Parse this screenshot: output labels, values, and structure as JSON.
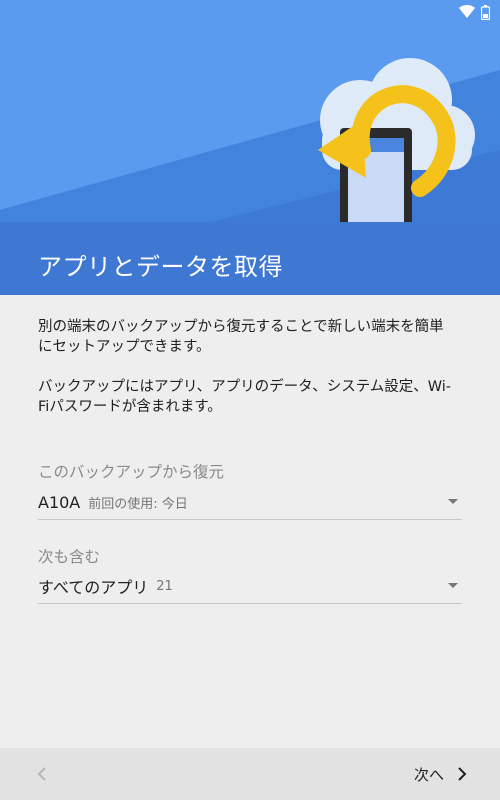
{
  "status_bar": {
    "wifi_icon": "wifi-icon",
    "battery_icon": "battery-icon"
  },
  "header": {
    "title": "アプリとデータを取得",
    "accent": "#3f78d2"
  },
  "content": {
    "description_1": "別の端末のバックアップから復元することで新しい端末を簡単にセットアップできます。",
    "description_2": "バックアップにはアプリ、アプリのデータ、システム設定、Wi-Fiパスワードが含まれます。",
    "restore_label": "このバックアップから復元",
    "restore_value": "A10A",
    "restore_sub": "前回の使用: 今日",
    "include_label": "次も含む",
    "include_value": "すべてのアプリ",
    "include_count": "21"
  },
  "footer": {
    "next_label": "次へ"
  }
}
